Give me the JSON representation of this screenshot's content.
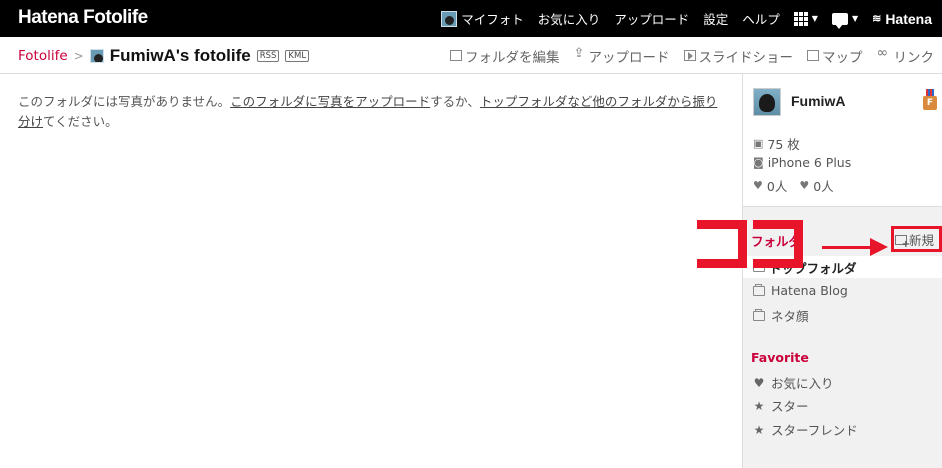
{
  "header": {
    "logo": "Hatena Fotolife",
    "nav": {
      "my_photo": "マイフォト",
      "favorites": "お気に入り",
      "upload": "アップロード",
      "settings": "設定",
      "help": "ヘルプ",
      "brand": "Hatena"
    }
  },
  "subheader": {
    "breadcrumb_root": "Fotolife",
    "breadcrumb_sep": ">",
    "title": "FumiwA's fotolife",
    "tags": [
      "RSS",
      "KML"
    ],
    "actions": {
      "edit_folder": "フォルダを編集",
      "upload": "アップロード",
      "slideshow": "スライドショー",
      "map": "マップ",
      "link": "リンク"
    }
  },
  "main": {
    "msg_prefix": "このフォルダには写真がありません。",
    "link_upload": "このフォルダに写真をアップロード",
    "msg_mid": "するか、",
    "link_move": "トップフォルダなど他のフォルダから振り分け",
    "msg_suffix": "てください。"
  },
  "sidebar": {
    "username": "FumiwA",
    "badge_letter": "F",
    "photo_count": "75 枚",
    "camera": "iPhone 6 Plus",
    "favorites_count": "0人",
    "favorited_by_count": "0人",
    "folder_section_title": "フォルダ",
    "new_label": "新規",
    "folders": [
      "トップフォルダ",
      "Hatena Blog",
      "ネタ顔"
    ],
    "favorite_section_title": "Favorite",
    "favorite_items": [
      "お気に入り",
      "スター",
      "スターフレンド"
    ]
  },
  "colors": {
    "accent": "#c9003a",
    "annotation_red": "#e8152a",
    "topbar": "#000000"
  }
}
